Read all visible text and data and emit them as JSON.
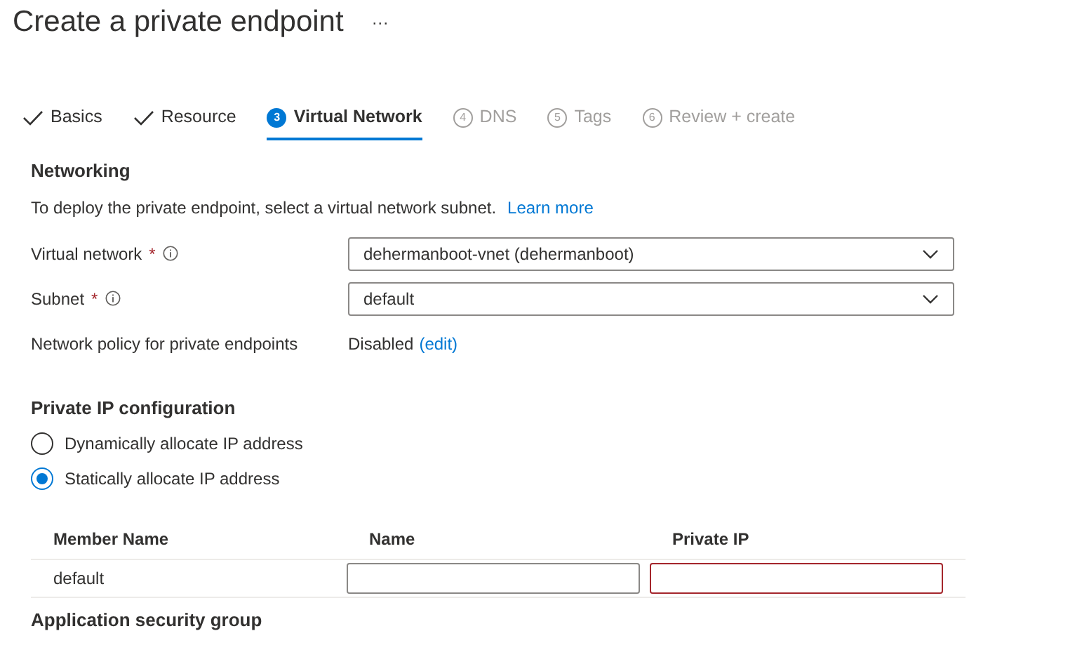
{
  "page_title": "Create a private endpoint",
  "more_button": "···",
  "tabs": [
    {
      "label": "Basics",
      "kind": "done",
      "selected": false
    },
    {
      "label": "Resource",
      "kind": "done",
      "selected": false
    },
    {
      "label": "Virtual Network",
      "kind": "current",
      "step": "3",
      "selected": true
    },
    {
      "label": "DNS",
      "kind": "upcoming",
      "step": "4",
      "selected": false
    },
    {
      "label": "Tags",
      "kind": "upcoming",
      "step": "5",
      "selected": false
    },
    {
      "label": "Review + create",
      "kind": "upcoming",
      "step": "6",
      "selected": false
    }
  ],
  "networking": {
    "heading": "Networking",
    "description": "To deploy the private endpoint, select a virtual network subnet.",
    "link": "Learn more",
    "fields": [
      {
        "kind": "dropdown",
        "label": "Virtual network",
        "required_mark": "*",
        "info": true,
        "value": "dehermanboot-vnet (dehermanboot)"
      },
      {
        "kind": "dropdown",
        "label": "Subnet",
        "required_mark": "*",
        "info": true,
        "value": "default"
      },
      {
        "kind": "text",
        "label": "Network policy for private endpoints",
        "value": "Disabled",
        "link": "(edit)"
      }
    ]
  },
  "private_ip": {
    "heading": "Private IP configuration",
    "options": [
      {
        "label": "Dynamically allocate IP address",
        "selected": false
      },
      {
        "label": "Statically allocate IP address",
        "selected": true
      }
    ],
    "table": {
      "columns": [
        "Member Name",
        "Name",
        "Private IP"
      ],
      "rows": [
        {
          "member_name": "default",
          "name": {
            "invalid": false
          },
          "private_ip": {
            "invalid": true
          }
        }
      ]
    }
  },
  "next_heading": "Application security group"
}
